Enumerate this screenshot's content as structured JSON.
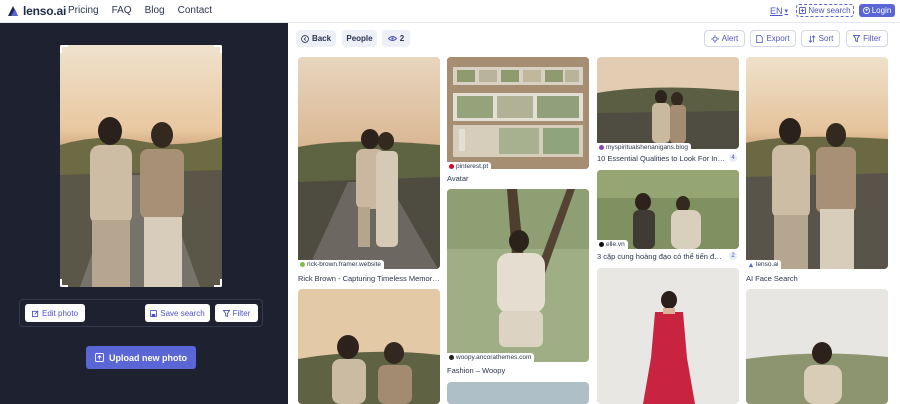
{
  "header": {
    "logo_text": "lenso.ai",
    "nav": [
      "Pricing",
      "FAQ",
      "Blog",
      "Contact"
    ],
    "language": "EN",
    "new_search_label": "New search",
    "login_label": "Login"
  },
  "left_panel": {
    "edit_photo_label": "Edit photo",
    "save_search_label": "Save search",
    "filter_label": "Filter",
    "upload_label": "Upload new photo"
  },
  "results_toolbar": {
    "back_label": "Back",
    "people_label": "People",
    "views_count": "2",
    "alert_label": "Alert",
    "export_label": "Export",
    "sort_label": "Sort",
    "filter_label": "Filter"
  },
  "results": [
    {
      "source": "rick-brown.framer.website",
      "title": "Rick Brown - Capturing Timeless Memories",
      "dot_color": "#7bc043"
    },
    {
      "source": "pinterest.pt",
      "title": "Avatar",
      "dot_color": "#e60023"
    },
    {
      "source": "myspiritualshenanigans.blog",
      "title": "10 Essential Qualities to Look For In An ...",
      "badge": "4",
      "dot_color": "#8e44ad"
    },
    {
      "source": "lenso.ai",
      "title": "AI Face Search",
      "dot_color": "#5b66d6"
    },
    {
      "source": "woopy.ancorathemes.com",
      "title": "Fashion – Woopy",
      "dot_color": "#222222"
    },
    {
      "source": "elle.vn",
      "title": "3 cặp cung hoàng đạo có thể tiến đến h...",
      "badge": "2",
      "dot_color": "#111111"
    }
  ]
}
